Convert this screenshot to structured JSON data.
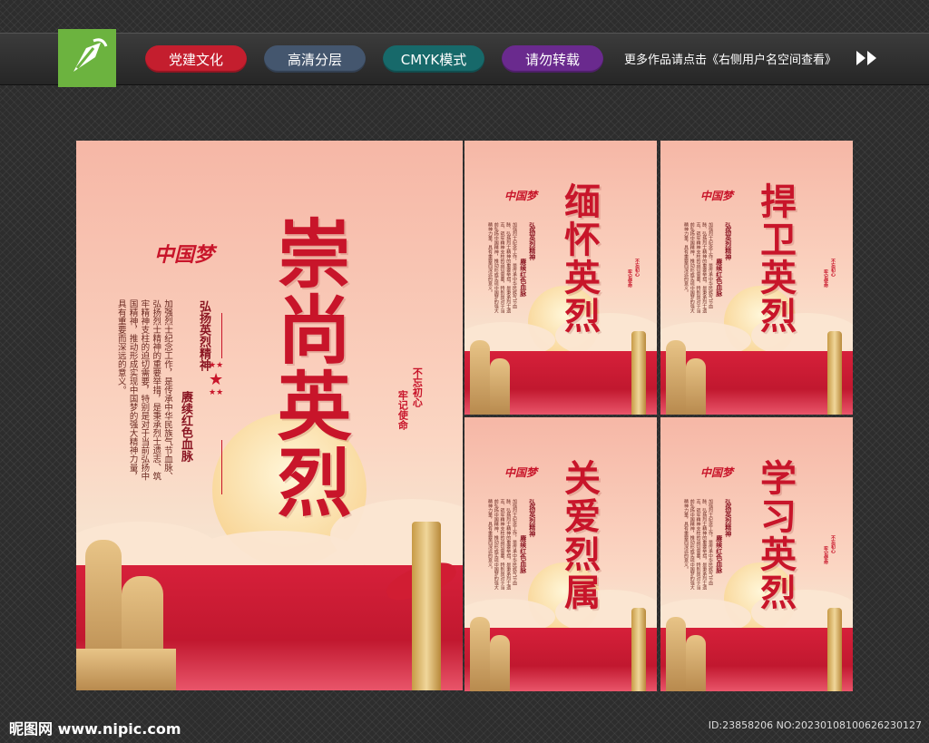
{
  "header": {
    "tags": [
      {
        "label": "党建文化",
        "color": "#c41e2e"
      },
      {
        "label": "高清分层",
        "color": "#44566e"
      },
      {
        "label": "CMYK模式",
        "color": "#17696a"
      },
      {
        "label": "请勿转载",
        "color": "#6a2a8e"
      }
    ],
    "more_text": "更多作品请点击《右侧用户名空间查看》"
  },
  "main_poster": {
    "title": "崇尚英烈",
    "brand": "中国梦",
    "subtitle_1": "弘扬英烈精神",
    "subtitle_2": "赓续红色血脉",
    "body": "加强烈士纪念工作，是传承中华民族气节血脉、弘扬烈士精神的重要举措，是秉承烈士遗志、筑牢精神支柱的迫切需要，特别是对于当前弘扬中国精神，推动形成实现中国梦的强大精神力量，具有重要而深远的意义。",
    "side_1": "不忘初心",
    "side_2": "牢记使命"
  },
  "small_posters": [
    {
      "title": "缅怀英烈"
    },
    {
      "title": "捍卫英烈"
    },
    {
      "title": "关爱烈属"
    },
    {
      "title": "学习英烈"
    }
  ],
  "footer": {
    "site": "昵图网 www.nipic.com",
    "id_text": "ID:23858206 NO:20230108100626230127"
  }
}
